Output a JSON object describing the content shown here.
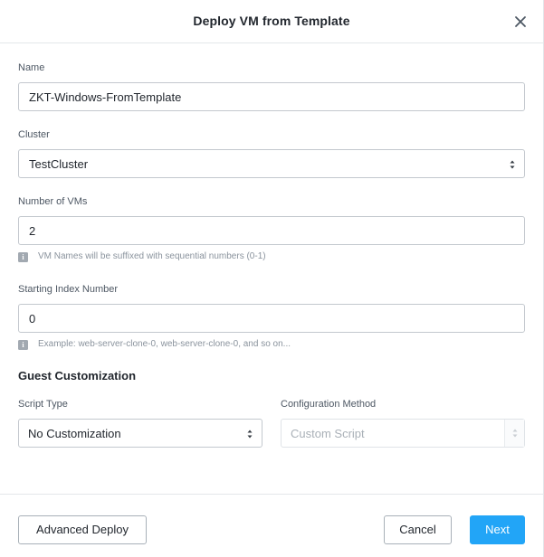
{
  "dialog": {
    "title": "Deploy VM from Template"
  },
  "form": {
    "name": {
      "label": "Name",
      "value": "ZKT-Windows-FromTemplate"
    },
    "cluster": {
      "label": "Cluster",
      "value": "TestCluster"
    },
    "num_vms": {
      "label": "Number of VMs",
      "value": "2",
      "hint": "VM Names will be suffixed with sequential numbers (0-1)"
    },
    "start_index": {
      "label": "Starting Index Number",
      "value": "0",
      "hint": "Example: web-server-clone-0, web-server-clone-0, and so on..."
    },
    "guest_customization": {
      "title": "Guest Customization",
      "script_type": {
        "label": "Script Type",
        "value": "No Customization"
      },
      "config_method": {
        "label": "Configuration Method",
        "value": "Custom Script"
      }
    }
  },
  "footer": {
    "advanced_label": "Advanced Deploy",
    "cancel_label": "Cancel",
    "next_label": "Next"
  },
  "colors": {
    "primary": "#22a5f7",
    "border": "#c3c8ce",
    "text": "#22272e",
    "hint": "#8a939d"
  }
}
